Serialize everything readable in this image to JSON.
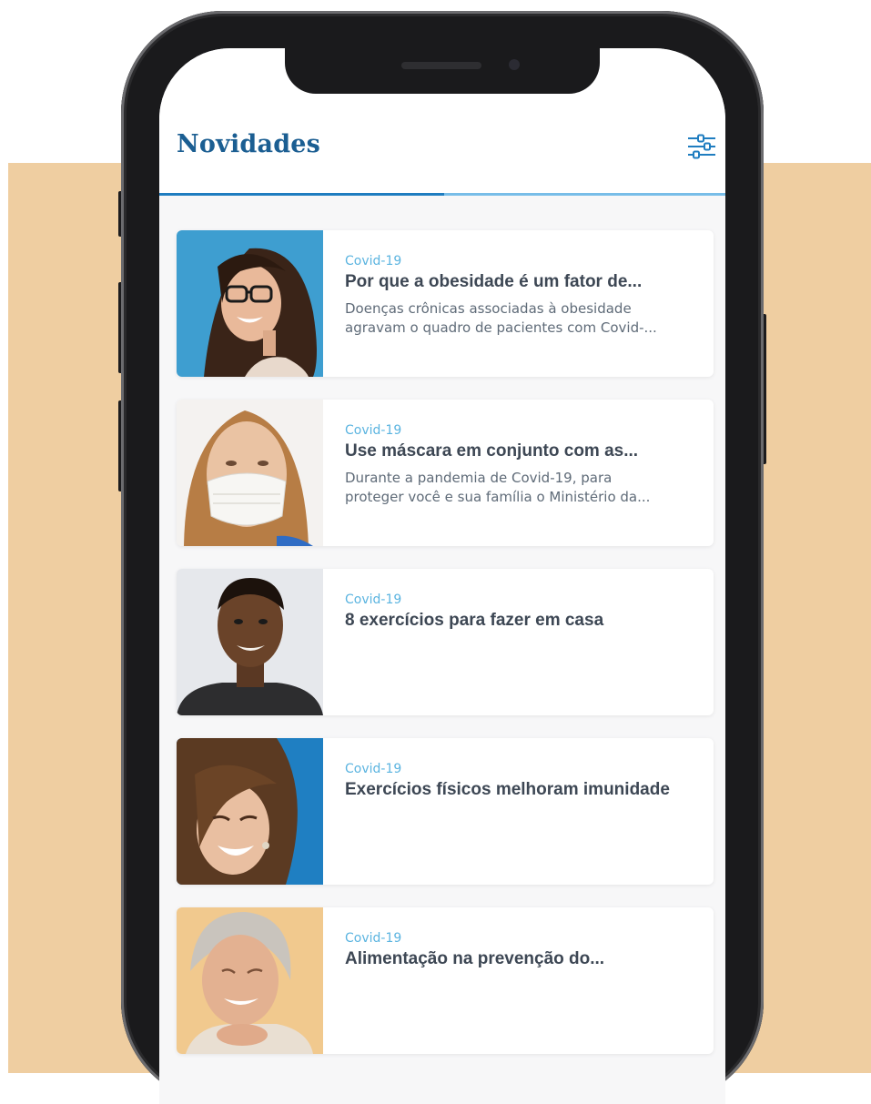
{
  "header": {
    "title": "Novidades",
    "filter_icon": "sliders-icon"
  },
  "colors": {
    "background_panel": "#efcea1",
    "title": "#1b5e92",
    "tag": "#5bb4e0",
    "tab_active": "#1f7dc0",
    "tab_track": "#78bde8"
  },
  "tabs": {
    "active_index": 0,
    "count": 2
  },
  "news": [
    {
      "tag": "Covid-19",
      "title": "Por que a obesidade é um fator de...",
      "description": "Doenças crônicas associadas à obesidade\nagravam o quadro de pacientes com Covid-...",
      "image": "woman-with-glasses-photo"
    },
    {
      "tag": "Covid-19",
      "title": "Use máscara em conjunto com as...",
      "description": "Durante a pandemia de Covid-19, para\nproteger você e sua família o Ministério da...",
      "image": "woman-wearing-mask-photo"
    },
    {
      "tag": "Covid-19",
      "title": "8 exercícios para fazer em casa",
      "description": "",
      "image": "smiling-man-photo"
    },
    {
      "tag": "Covid-19",
      "title": "Exercícios físicos melhoram imunidade",
      "description": "",
      "image": "laughing-woman-photo"
    },
    {
      "tag": "Covid-19",
      "title": "Alimentação na prevenção do...",
      "description": "",
      "image": "elderly-woman-photo"
    }
  ]
}
